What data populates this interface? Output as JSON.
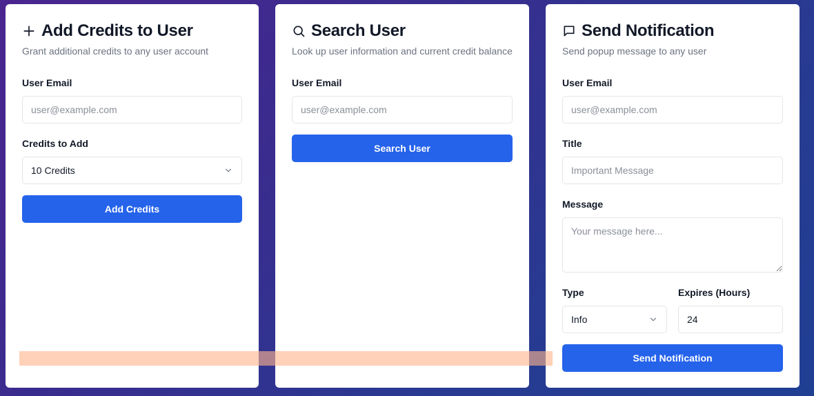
{
  "add_credits": {
    "title": "Add Credits to User",
    "description": "Grant additional credits to any user account",
    "email_label": "User Email",
    "email_placeholder": "user@example.com",
    "credits_label": "Credits to Add",
    "credits_selected": "10 Credits",
    "button_label": "Add Credits",
    "icon": "plus-icon"
  },
  "search_user": {
    "title": "Search User",
    "description": "Look up user information and current credit balance",
    "email_label": "User Email",
    "email_placeholder": "user@example.com",
    "button_label": "Search User",
    "icon": "search-icon"
  },
  "send_notification": {
    "title": "Send Notification",
    "description": "Send popup message to any user",
    "email_label": "User Email",
    "email_placeholder": "user@example.com",
    "title_label": "Title",
    "title_placeholder": "Important Message",
    "message_label": "Message",
    "message_placeholder": "Your message here...",
    "type_label": "Type",
    "type_selected": "Info",
    "expires_label": "Expires (Hours)",
    "expires_value": "24",
    "button_label": "Send Notification",
    "icon": "message-square-icon"
  },
  "colors": {
    "primary_button": "#2563eb",
    "background_gradient_start": "#4a2590",
    "background_gradient_end": "#1f3f93",
    "overlay_highlight": "#ffb48c"
  }
}
